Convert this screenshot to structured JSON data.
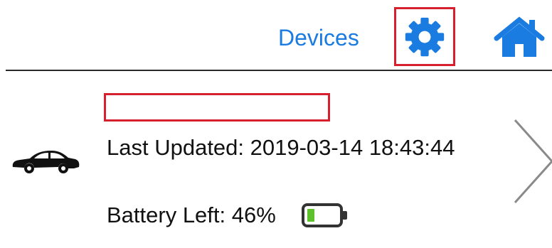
{
  "nav": {
    "devices_label": "Devices",
    "settings_icon": "gear-icon",
    "home_icon": "home-icon"
  },
  "device": {
    "name": "",
    "icon": "car-icon",
    "last_updated": "Last Updated: 2019-03-14 18:43:44",
    "battery_text": "Battery Left: 46%",
    "battery_level_percent": 46,
    "battery_icon": "battery-icon",
    "chevron_icon": "chevron-right-icon"
  },
  "colors": {
    "accent_blue": "#1a7be0",
    "highlight_red": "#d62030",
    "battery_green": "#5cc12b",
    "divider": "#2a2a2a"
  }
}
